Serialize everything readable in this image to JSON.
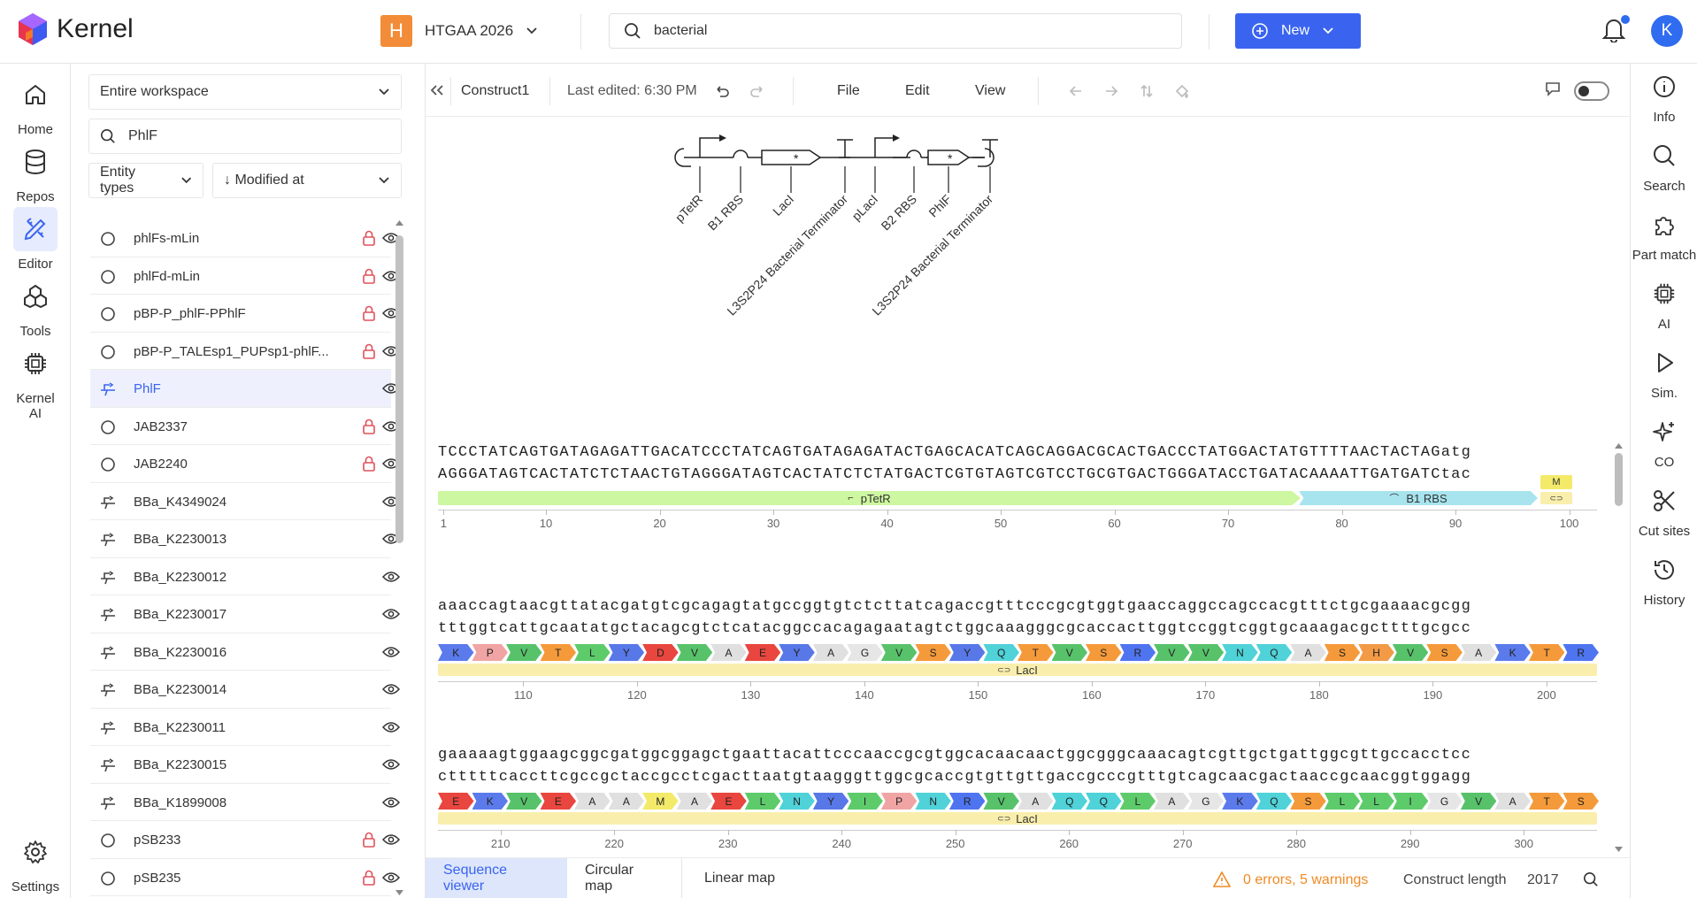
{
  "app": {
    "name": "Kernel"
  },
  "workspace": {
    "badge": "H",
    "name": "HTGAA 2026"
  },
  "search": {
    "value": "bacterial"
  },
  "new_button": {
    "label": "New"
  },
  "user": {
    "initial": "K"
  },
  "left_rail": [
    {
      "label": "Home",
      "icon": "home-icon"
    },
    {
      "label": "Repos",
      "icon": "database-icon"
    },
    {
      "label": "Editor",
      "icon": "pencil-ruler-icon",
      "active": true
    },
    {
      "label": "Tools",
      "icon": "tools-icon"
    },
    {
      "label": "Kernel AI",
      "icon": "chip-icon"
    },
    {
      "label": "Settings",
      "icon": "gear-icon"
    }
  ],
  "panel": {
    "scope": "Entire workspace",
    "filter_value": "PhlF",
    "entity_types_label": "Entity types",
    "sort_label": "↓ Modified at",
    "items": [
      {
        "name": "phlFs-mLin",
        "type": "circle",
        "locked": true
      },
      {
        "name": "phlFd-mLin",
        "type": "circle",
        "locked": true
      },
      {
        "name": "pBP-P_phlF-PPhlF",
        "type": "circle",
        "locked": true
      },
      {
        "name": "pBP-P_TALEsp1_PUPsp1-phlF...",
        "type": "circle",
        "locked": true
      },
      {
        "name": "PhlF",
        "type": "part",
        "locked": false,
        "active": true
      },
      {
        "name": "JAB2337",
        "type": "circle",
        "locked": true
      },
      {
        "name": "JAB2240",
        "type": "circle",
        "locked": true
      },
      {
        "name": "BBa_K4349024",
        "type": "part",
        "locked": false
      },
      {
        "name": "BBa_K2230013",
        "type": "part",
        "locked": false
      },
      {
        "name": "BBa_K2230012",
        "type": "part",
        "locked": false
      },
      {
        "name": "BBa_K2230017",
        "type": "part",
        "locked": false
      },
      {
        "name": "BBa_K2230016",
        "type": "part",
        "locked": false
      },
      {
        "name": "BBa_K2230014",
        "type": "part",
        "locked": false
      },
      {
        "name": "BBa_K2230011",
        "type": "part",
        "locked": false
      },
      {
        "name": "BBa_K2230015",
        "type": "part",
        "locked": false
      },
      {
        "name": "BBa_K1899008",
        "type": "part",
        "locked": false
      },
      {
        "name": "pSB233",
        "type": "circle",
        "locked": true
      },
      {
        "name": "pSB235",
        "type": "circle",
        "locked": true
      }
    ]
  },
  "editor": {
    "construct_name": "Construct1",
    "last_edited": "Last edited: 6:30 PM",
    "menus": [
      "File",
      "Edit",
      "View"
    ]
  },
  "diagram": {
    "parts": [
      "pTetR",
      "B1 RBS",
      "LacI",
      "L3S2P24 Bacterial Terminator",
      "pLacI",
      "B2 RBS",
      "PhlF",
      "L3S2P24 Bacterial Terminator"
    ]
  },
  "sequence": {
    "rows": [
      {
        "top": "TCCCTATCAGTGATAGAGATTGACATCCCTATCAGTGATAGAGATACTGAGCACATCAGCAGGACGCACTGACCCTATGGACTATGTTTTAACTACTAGatg",
        "bottom": "AGGGATAGTCACTATCTCTAACTGTAGGGATAGTCACTATCTCTATGACTCGTGTAGTCGTCCTGCGTGACTGGGATACCTGATACAAAATTGATGATCtac",
        "ticks": [
          "1",
          "10",
          "20",
          "30",
          "40",
          "50",
          "60",
          "70",
          "80",
          "90",
          "100"
        ],
        "features": [
          {
            "name": "pTetR",
            "color": "#cdf7a0"
          },
          {
            "name": "B1 RBS",
            "color": "#a7e4ee"
          },
          {
            "name": "M",
            "color": "#f4ea6a"
          }
        ]
      },
      {
        "top": "aaaccagtaacgttatacgatgtcgcagagtatgccggtgtctcttatcagaccgtttcccgcgtggtgaaccaggccagccacgtttctgcgaaaacgcgg",
        "bottom": "tttggtcattgcaatatgctacagcgtctcatacggccacagagaatagtctggcaaagggcgcaccacttggtccggtcggtgcaaagacgcttttgcgcc",
        "ticks": [
          "110",
          "120",
          "130",
          "140",
          "150",
          "160",
          "170",
          "180",
          "190",
          "200"
        ],
        "aa": [
          "K",
          "P",
          "V",
          "T",
          "L",
          "Y",
          "D",
          "V",
          "A",
          "E",
          "Y",
          "A",
          "G",
          "V",
          "S",
          "Y",
          "Q",
          "T",
          "V",
          "S",
          "R",
          "V",
          "V",
          "N",
          "Q",
          "A",
          "S",
          "H",
          "V",
          "S",
          "A",
          "K",
          "T",
          "R"
        ],
        "feature": "LacI"
      },
      {
        "top": "gaaaaagtggaagcggcgatggcggagctgaattacattcccaaccgcgtggcacaacaactggcgggcaaacagtcgttgctgattggcgttgccacctcc",
        "bottom": "ctttttcaccttcgccgctaccgcctcgacttaatgtaagggttggcgcaccgtgttgttgaccgcccgtttgtcagcaacgactaaccgcaacggtggagg",
        "ticks": [
          "210",
          "220",
          "230",
          "240",
          "250",
          "260",
          "270",
          "280",
          "290",
          "300"
        ],
        "aa": [
          "E",
          "K",
          "V",
          "E",
          "A",
          "A",
          "M",
          "A",
          "E",
          "L",
          "N",
          "Y",
          "I",
          "P",
          "N",
          "R",
          "V",
          "A",
          "Q",
          "Q",
          "L",
          "A",
          "G",
          "K",
          "Q",
          "S",
          "L",
          "L",
          "I",
          "G",
          "V",
          "A",
          "T",
          "S"
        ],
        "feature": "LacI"
      }
    ]
  },
  "bottom_tabs": [
    "Sequence viewer",
    "Circular map",
    "Linear map"
  ],
  "status": {
    "warnings": "0 errors, 5 warnings",
    "length_label": "Construct length",
    "length_value": "2017"
  },
  "right_rail": [
    {
      "label": "Info",
      "icon": "info-icon"
    },
    {
      "label": "Search",
      "icon": "search-icon"
    },
    {
      "label": "Part match",
      "icon": "puzzle-icon"
    },
    {
      "label": "AI",
      "icon": "chip-icon"
    },
    {
      "label": "Sim.",
      "icon": "play-icon"
    },
    {
      "label": "CO",
      "icon": "sparkle-icon"
    },
    {
      "label": "Cut sites",
      "icon": "scissors-icon"
    },
    {
      "label": "History",
      "icon": "history-icon"
    }
  ],
  "colors": {
    "accent": "#3a64f0",
    "workspace_badge": "#f28c38",
    "lock": "#e0505a",
    "warning": "#f08a24",
    "aa_palette": {
      "K": "#5b7bec",
      "R": "#4f74f0",
      "H": "#f29a46",
      "P": "#f0a4a4",
      "V": "#58c26a",
      "T": "#f59a3a",
      "L": "#5ecb6b",
      "Y": "#5878e8",
      "D": "#e8463e",
      "A": "#e0e0e0",
      "E": "#e8463e",
      "G": "#e6e6e6",
      "S": "#f59a3a",
      "Q": "#4fd2d8",
      "N": "#4fd2d8",
      "M": "#f4ea6a",
      "I": "#5ecb6b"
    }
  }
}
